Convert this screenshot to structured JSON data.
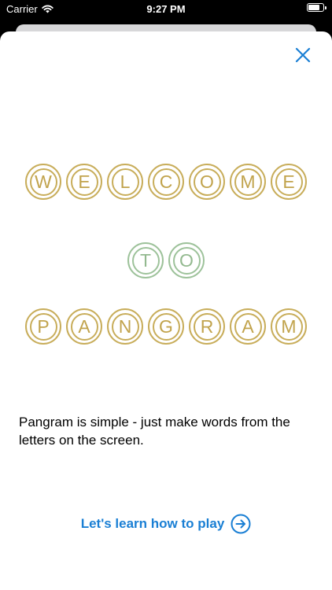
{
  "status_bar": {
    "carrier": "Carrier",
    "time": "9:27 PM",
    "battery_level": 0.85
  },
  "header": {
    "close_icon": "close-icon"
  },
  "title": {
    "rows": [
      {
        "letters": [
          "W",
          "E",
          "L",
          "C",
          "O",
          "M",
          "E"
        ],
        "color": "#c8ad5a"
      },
      {
        "letters": [
          "T",
          "O"
        ],
        "color": "#9dc29a"
      },
      {
        "letters": [
          "P",
          "A",
          "N",
          "G",
          "R",
          "A",
          "M"
        ],
        "color": "#c8ad5a"
      }
    ]
  },
  "description": "Pangram is simple - just make words from the letters on the screen.",
  "cta": {
    "label": "Let's learn how to play",
    "icon": "arrow-right-circle-icon",
    "color": "#1a7fd4"
  }
}
